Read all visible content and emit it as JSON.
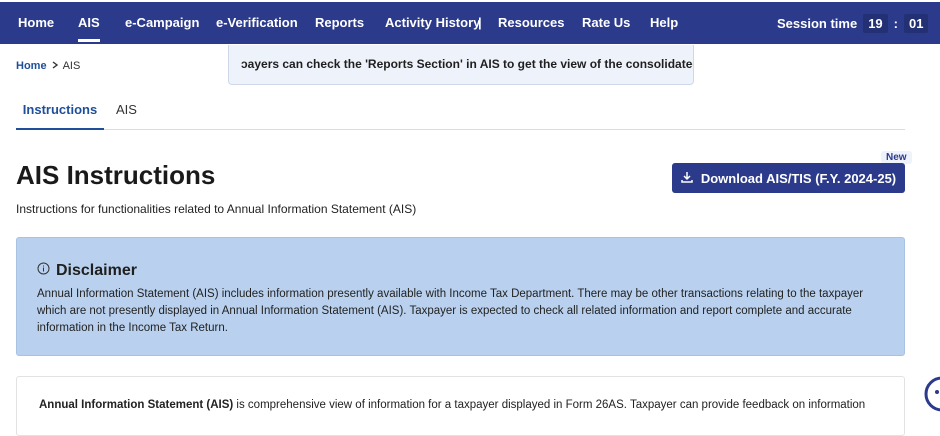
{
  "nav": {
    "items": [
      "Home",
      "AIS",
      "e-Campaign",
      "e-Verification",
      "Reports",
      "Activity History",
      "Resources",
      "Rate Us",
      "Help"
    ],
    "separator": "|",
    "session_label": "Session time",
    "session_min": "19",
    "session_colon": ":",
    "session_sec": "01"
  },
  "breadcrumb": {
    "home": "Home",
    "current": "AIS"
  },
  "marquee": "ɔayers can check the 'Reports Section' in AIS to get the view of the consolidated sun",
  "tabs": [
    "Instructions",
    "AIS"
  ],
  "page": {
    "title": "AIS Instructions",
    "subtitle": "Instructions for functionalities related to Annual Information Statement (AIS)",
    "new_badge": "New",
    "download_label": "Download AIS/TIS (F.Y. 2024-25)"
  },
  "disclaimer": {
    "title": "Disclaimer",
    "text": "Annual Information Statement (AIS) includes information presently available with Income Tax Department. There may be other transactions relating to the taxpayer which are not presently displayed in Annual Information Statement (AIS). Taxpayer is expected to check all related information and report complete and accurate information in the Income Tax Return."
  },
  "info": {
    "bold": "Annual Information Statement (AIS)",
    "text": " is comprehensive view of information for a taxpayer displayed in Form 26AS. Taxpayer can provide feedback on information"
  },
  "colors": {
    "nav_bg": "#2b3a8a",
    "disclaimer_bg": "#b9d1ee",
    "accent": "#1f4f9a"
  }
}
